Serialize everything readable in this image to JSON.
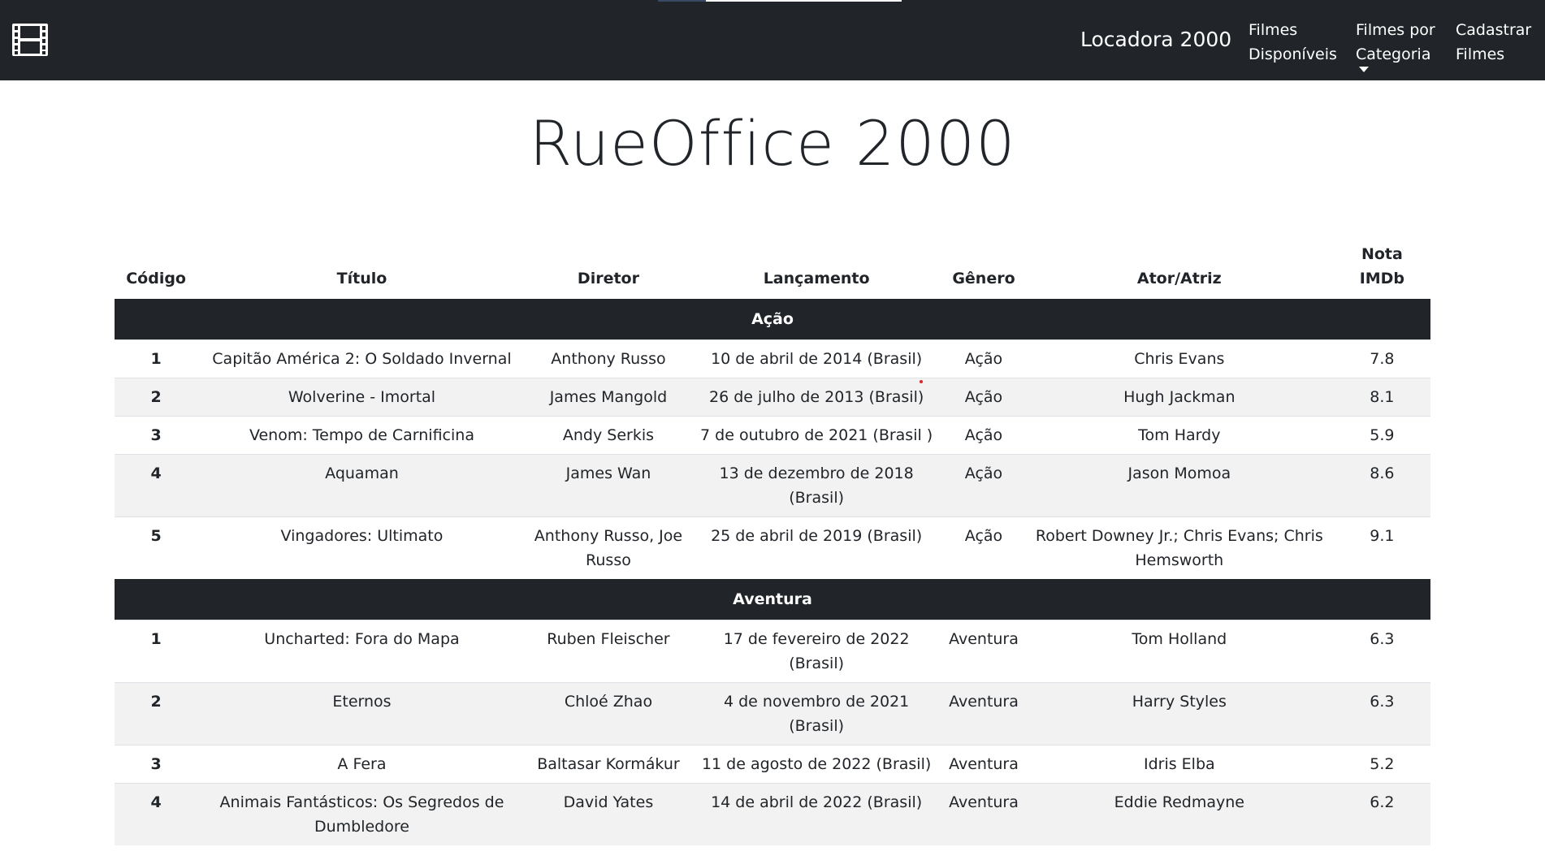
{
  "navbar": {
    "brand": "Locadora 2000",
    "links": [
      {
        "line1": "Filmes",
        "line2": "Disponíveis"
      },
      {
        "line1": "Filmes por",
        "line2": "Categoria"
      },
      {
        "line1": "Cadastrar",
        "line2": "Filmes"
      }
    ],
    "logo_icon": "film-strip-icon",
    "dropdown_icon": "caret-down-icon"
  },
  "page": {
    "title": "RueOffice 2000"
  },
  "table": {
    "headers": {
      "codigo": "Código",
      "titulo": "Título",
      "diretor": "Diretor",
      "lancamento": "Lançamento",
      "genero": "Gênero",
      "ator": "Ator/Atriz",
      "nota_line1": "Nota",
      "nota_line2": "IMDb"
    },
    "groups": [
      {
        "name": "Ação",
        "rows": [
          {
            "codigo": "1",
            "titulo": "Capitão América 2: O Soldado Invernal",
            "diretor": "Anthony Russo",
            "lancamento": "10 de abril de 2014 (Brasil)",
            "genero": "Ação",
            "ator": "Chris Evans",
            "nota": "7.8"
          },
          {
            "codigo": "2",
            "titulo": "Wolverine - Imortal",
            "diretor": "James Mangold",
            "lancamento": "26 de julho de 2013 (Brasil)",
            "genero": "Ação",
            "ator": "Hugh Jackman",
            "nota": "8.1"
          },
          {
            "codigo": "3",
            "titulo": "Venom: Tempo de Carnificina",
            "diretor": "Andy Serkis",
            "lancamento": "7 de outubro de 2021 (Brasil )",
            "genero": "Ação",
            "ator": "Tom Hardy",
            "nota": "5.9"
          },
          {
            "codigo": "4",
            "titulo": "Aquaman",
            "diretor": "James Wan",
            "lancamento": "13 de dezembro de 2018 (Brasil)",
            "genero": "Ação",
            "ator": "Jason Momoa",
            "nota": "8.6"
          },
          {
            "codigo": "5",
            "titulo": "Vingadores: Ultimato",
            "diretor": "Anthony Russo, Joe Russo",
            "lancamento": "25 de abril de 2019 (Brasil)",
            "genero": "Ação",
            "ator": "Robert Downey Jr.; Chris Evans; Chris Hemsworth",
            "nota": "9.1"
          }
        ]
      },
      {
        "name": "Aventura",
        "rows": [
          {
            "codigo": "1",
            "titulo": "Uncharted: Fora do Mapa",
            "diretor": "Ruben Fleischer",
            "lancamento": "17 de fevereiro de 2022 (Brasil)",
            "genero": "Aventura",
            "ator": "Tom Holland",
            "nota": "6.3"
          },
          {
            "codigo": "2",
            "titulo": "Eternos",
            "diretor": "Chloé Zhao",
            "lancamento": "4 de novembro de 2021 (Brasil)",
            "genero": "Aventura",
            "ator": "Harry Styles",
            "nota": "6.3"
          },
          {
            "codigo": "3",
            "titulo": "A Fera",
            "diretor": "Baltasar Kormákur",
            "lancamento": "11 de agosto de 2022 (Brasil)",
            "genero": "Aventura",
            "ator": "Idris Elba",
            "nota": "5.2"
          },
          {
            "codigo": "4",
            "titulo": "Animais Fantásticos: Os Segredos de Dumbledore",
            "diretor": "David Yates",
            "lancamento": "14 de abril de 2022 (Brasil)",
            "genero": "Aventura",
            "ator": "Eddie Redmayne",
            "nota": "6.2"
          }
        ]
      }
    ]
  }
}
